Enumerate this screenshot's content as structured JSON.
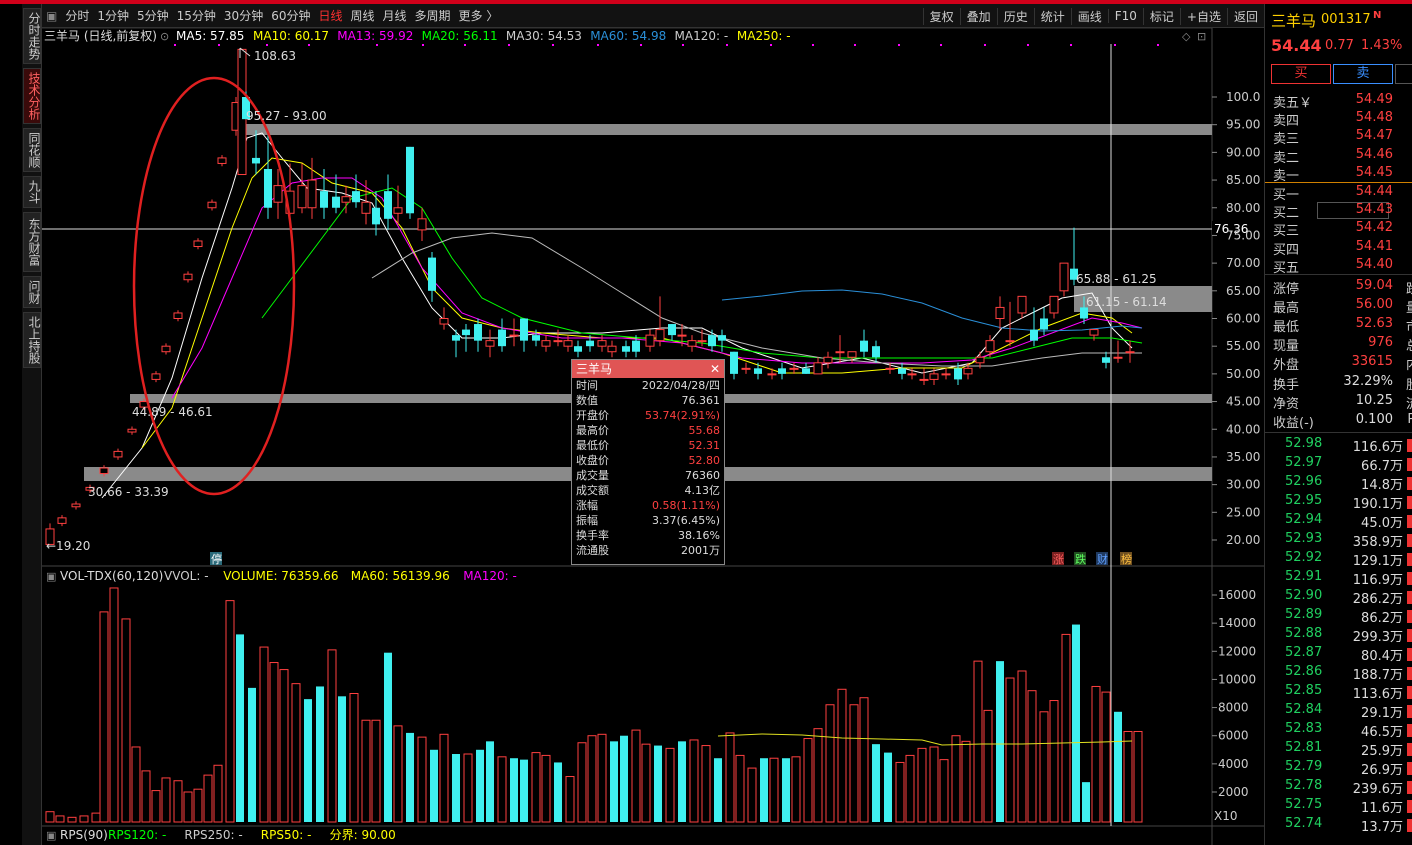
{
  "toolbar": {
    "periods": [
      "分时",
      "1分钟",
      "5分钟",
      "15分钟",
      "30分钟",
      "60分钟",
      "日线",
      "周线",
      "月线",
      "多周期",
      "更多 〉"
    ],
    "active_period": "日线",
    "right_items": [
      "复权",
      "叠加",
      "历史",
      "统计",
      "画线",
      "F10",
      "标记",
      "+自选",
      "返回"
    ]
  },
  "vtabs": [
    "分时走势",
    "技术分析",
    "同花顺",
    "九斗",
    "东方财富",
    "问财",
    "北上持股"
  ],
  "main_chart": {
    "title": "三羊马 (日线,前复权)",
    "ma_labels": [
      {
        "text": "MA5: 57.85",
        "color": "#ffffff"
      },
      {
        "text": "MA10: 60.17",
        "color": "#ffff00"
      },
      {
        "text": "MA13: 59.92",
        "color": "#ff00ff"
      },
      {
        "text": "MA20: 56.11",
        "color": "#00ff00"
      },
      {
        "text": "MA30: 54.53",
        "color": "#cccccc"
      },
      {
        "text": "MA60: 54.98",
        "color": "#2a8fd8"
      },
      {
        "text": "MA120: -",
        "color": "#cccccc"
      },
      {
        "text": "MA250: -",
        "color": "#ffff00"
      }
    ],
    "y_ticks": [
      "100.0",
      "95.00",
      "90.00",
      "85.00",
      "80.00",
      "75.00",
      "70.00",
      "65.00",
      "60.00",
      "55.00",
      "50.00",
      "45.00",
      "40.00",
      "35.00",
      "30.00",
      "25.00",
      "20.00"
    ],
    "annotations": {
      "high": "108.63",
      "low": "←19.20",
      "zone1": "95.27 - 93.00",
      "zone2": "44.89 - 46.61",
      "zone3": "30.66 - 33.39",
      "zone4": "65.88 - 61.25",
      "zone5": "61.15 - 61.14",
      "crosshair_price": "76.36",
      "ting": "停",
      "marks": [
        "涨",
        "跌",
        "财",
        "榜"
      ]
    }
  },
  "popup": {
    "title": "三羊马",
    "rows": [
      {
        "k": "时间",
        "v": "2022/04/28/四",
        "red": false
      },
      {
        "k": "数值",
        "v": "76.361",
        "red": false
      },
      {
        "k": "开盘价",
        "v": "53.74(2.91%)",
        "red": true
      },
      {
        "k": "最高价",
        "v": "55.68",
        "red": true
      },
      {
        "k": "最低价",
        "v": "52.31",
        "red": true
      },
      {
        "k": "收盘价",
        "v": "52.80",
        "red": true
      },
      {
        "k": "成交量",
        "v": "76360",
        "red": false
      },
      {
        "k": "成交额",
        "v": "4.13亿",
        "red": false
      },
      {
        "k": "涨幅",
        "v": "0.58(1.11%)",
        "red": true
      },
      {
        "k": "振幅",
        "v": "3.37(6.45%)",
        "red": false
      },
      {
        "k": "换手率",
        "v": "38.16%",
        "red": false
      },
      {
        "k": "流通股",
        "v": "2001万",
        "red": false
      }
    ]
  },
  "vol_chart": {
    "title": "VOL-TDX(60,120)",
    "labels": [
      {
        "text": "VVOL: -",
        "color": "#cccccc"
      },
      {
        "text": "VOLUME: 76359.66",
        "color": "#ffff00"
      },
      {
        "text": "MA60: 56139.96",
        "color": "#ffff00"
      },
      {
        "text": "MA120: -",
        "color": "#ff00ff"
      }
    ],
    "y_ticks": [
      "16000",
      "14000",
      "12000",
      "10000",
      "8000",
      "6000",
      "4000",
      "2000"
    ],
    "unit": "X10"
  },
  "rps_bar": {
    "title": "RPS(90)",
    "labels": [
      {
        "text": "RPS120: -",
        "color": "#00ff00"
      },
      {
        "text": "RPS250: -",
        "color": "#cccccc"
      },
      {
        "text": "RPS50: -",
        "color": "#ffff00"
      },
      {
        "text": "分界: 90.00",
        "color": "#ffff00"
      }
    ]
  },
  "right_panel": {
    "name": "三羊马",
    "code": "001317",
    "tag": "N",
    "price": "54.44",
    "change": "0.77",
    "pct": "1.43%",
    "buy_label": "买",
    "sell_label": "卖",
    "asks": [
      {
        "k": "卖五￥",
        "v": "54.49"
      },
      {
        "k": "卖四",
        "v": "54.48"
      },
      {
        "k": "卖三",
        "v": "54.47"
      },
      {
        "k": "卖二",
        "v": "54.46"
      },
      {
        "k": "卖一",
        "v": "54.45"
      }
    ],
    "bids": [
      {
        "k": "买一",
        "v": "54.44"
      },
      {
        "k": "买二",
        "v": "54.43"
      },
      {
        "k": "买三",
        "v": "54.42"
      },
      {
        "k": "买四",
        "v": "54.41"
      },
      {
        "k": "买五",
        "v": "54.40"
      }
    ],
    "stats": [
      {
        "k": "涨停",
        "v": "59.04",
        "extra": "跌"
      },
      {
        "k": "最高",
        "v": "56.00",
        "extra": "量"
      },
      {
        "k": "最低",
        "v": "52.63",
        "extra": "市"
      },
      {
        "k": "现量",
        "v": "976",
        "extra": "总"
      },
      {
        "k": "外盘",
        "v": "33615",
        "extra": "内"
      }
    ],
    "stats2": [
      {
        "k": "换手",
        "v": "32.29%",
        "extra": "股"
      },
      {
        "k": "净资",
        "v": "10.25",
        "extra": "流"
      },
      {
        "k": "收益(-)",
        "v": "0.100",
        "extra": "PI"
      }
    ],
    "ticks": [
      {
        "p": "52.98",
        "v": "116.6万"
      },
      {
        "p": "52.97",
        "v": "66.7万"
      },
      {
        "p": "52.96",
        "v": "14.8万"
      },
      {
        "p": "52.95",
        "v": "190.1万"
      },
      {
        "p": "52.94",
        "v": "45.0万"
      },
      {
        "p": "52.93",
        "v": "358.9万"
      },
      {
        "p": "52.92",
        "v": "129.1万"
      },
      {
        "p": "52.91",
        "v": "116.9万"
      },
      {
        "p": "52.90",
        "v": "286.2万"
      },
      {
        "p": "52.89",
        "v": "86.2万"
      },
      {
        "p": "52.88",
        "v": "299.3万"
      },
      {
        "p": "52.87",
        "v": "80.4万"
      },
      {
        "p": "52.86",
        "v": "188.7万"
      },
      {
        "p": "52.85",
        "v": "113.6万"
      },
      {
        "p": "52.84",
        "v": "29.1万"
      },
      {
        "p": "52.83",
        "v": "46.5万"
      },
      {
        "p": "52.81",
        "v": "25.9万"
      },
      {
        "p": "52.79",
        "v": "26.9万"
      },
      {
        "p": "52.78",
        "v": "239.6万"
      },
      {
        "p": "52.75",
        "v": "11.6万"
      },
      {
        "p": "52.74",
        "v": "13.7万"
      }
    ]
  },
  "colors": {
    "up": "#ff4040",
    "down": "#40f0f0",
    "bg": "#000000",
    "accent": "#d0001a"
  }
}
